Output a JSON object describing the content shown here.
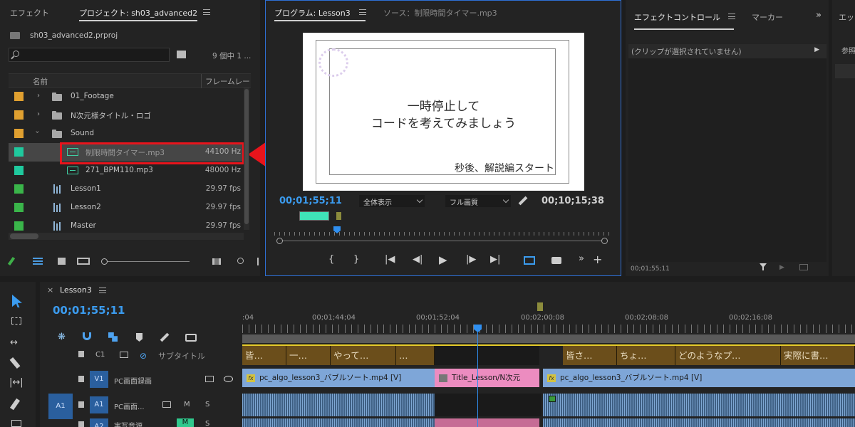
{
  "project_panel": {
    "tabs": [
      {
        "label": "エフェクト"
      },
      {
        "label": "プロジェクト: sh03_advanced2"
      }
    ],
    "file_name": "sh03_advanced2.prproj",
    "search_placeholder": "",
    "item_count": "9 個中 1 ...",
    "columns": {
      "name": "名前",
      "frame_rate": "フレームレー"
    },
    "items": [
      {
        "name": "01_Footage",
        "value": "",
        "swatch": "#e0a030",
        "type": "folder"
      },
      {
        "name": "N次元様タイトル・ロゴ",
        "value": "",
        "swatch": "#e0a030",
        "type": "folder"
      },
      {
        "name": "Sound",
        "value": "",
        "swatch": "#e0a030",
        "type": "folder"
      },
      {
        "name": "制限時間タイマー.mp3",
        "value": "44100 Hz",
        "swatch": "#1fc99e",
        "type": "audio"
      },
      {
        "name": "271_BPM110.mp3",
        "value": "48000 Hz",
        "swatch": "#1fc99e",
        "type": "audio"
      },
      {
        "name": "Lesson1",
        "value": "29.97 fps",
        "swatch": "#3ab54a",
        "type": "sequence"
      },
      {
        "name": "Lesson2",
        "value": "29.97 fps",
        "swatch": "#3ab54a",
        "type": "sequence"
      },
      {
        "name": "Master",
        "value": "29.97 fps",
        "swatch": "#3ab54a",
        "type": "sequence"
      }
    ],
    "highlight_color": "#e8141c"
  },
  "program_monitor": {
    "tabs": [
      {
        "label": "プログラム: Lesson3"
      },
      {
        "label": "ソース：制限時間タイマー.mp3"
      }
    ],
    "canvas_text_line1": "一時停止して",
    "canvas_text_line2": "コードを考えてみましょう",
    "canvas_text_bottom": "秒後、解説編スタート",
    "timecode": "00;01;55;11",
    "zoom": "全体表示",
    "quality": "フル画質",
    "duration": "00;10;15;38"
  },
  "effect_controls": {
    "tabs": [
      {
        "label": "エフェクトコントロール"
      },
      {
        "label": "マーカー"
      }
    ],
    "extra_tab": "エッ",
    "extra_label": "参照",
    "no_clip_message": "(クリップが選択されていません)",
    "footer_timecode": "00;01;55;11"
  },
  "timeline": {
    "sequence_name": "Lesson3",
    "timecode": "00;01;55;11",
    "ruler_labels": [
      ":04",
      "00;01;44;04",
      "00;01;52;04",
      "00;02;00;08",
      "00;02;08;08",
      "00;02;16;08"
    ],
    "tracks": {
      "c1": {
        "label": "C1",
        "name": "サブタイトル"
      },
      "v1": {
        "label": "V1",
        "name": "PC画面録画"
      },
      "a1": {
        "label": "A1",
        "name": "PC画面...",
        "m": "M",
        "s": "S"
      },
      "a2": {
        "label": "A2",
        "name": "実写音源",
        "m": "M",
        "s": "S"
      }
    },
    "a1_source_label": "A1",
    "captions": [
      "皆…",
      "一…",
      "やって…",
      "…",
      "皆さ…",
      "ちょ…",
      "どのようなプ…",
      "実際に書…"
    ],
    "video_clips": [
      {
        "label": "pc_algo_lesson3_バブルソート.mp4 [V]",
        "color": "#7ea6d8"
      },
      {
        "label": "Title_Lesson/N次元",
        "color": "#ec8cc0"
      },
      {
        "label": "pc_algo_lesson3_バブルソート.mp4 [V]",
        "color": "#7ea6d8"
      }
    ]
  }
}
